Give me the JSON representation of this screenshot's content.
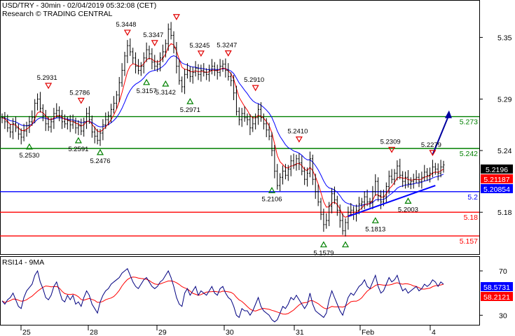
{
  "header": {
    "title": "USD/TRY - 30min - 02/04/2019 05:32:08 (CET)",
    "subtitle": "Research © TRADING CENTRAL"
  },
  "rsi_panel": {
    "label": "RSI14 - 9MA"
  },
  "chart_data": [
    {
      "type": "line",
      "name": "price",
      "title": "USD/TRY - 30min - 02/04/2019 05:32:08 (CET)",
      "ylim": [
        5.14,
        5.385
      ],
      "y_ticks": [
        5.18,
        5.24,
        5.29,
        5.35
      ],
      "x_ticks": [
        "25",
        "28",
        "29",
        "30",
        "31",
        "Feb",
        "4"
      ],
      "series": [
        {
          "role": "close",
          "color": "#000000",
          "values": [
            5.272,
            5.268,
            5.262,
            5.258,
            5.266,
            5.262,
            5.256,
            5.253,
            5.259,
            5.264,
            5.268,
            5.272,
            5.286,
            5.29,
            5.281,
            5.274,
            5.266,
            5.263,
            5.268,
            5.276,
            5.279,
            5.274,
            5.268,
            5.266,
            5.269,
            5.265,
            5.268,
            5.262,
            5.264,
            5.259,
            5.268,
            5.276,
            5.27,
            5.258,
            5.254,
            5.25,
            5.257,
            5.265,
            5.27,
            5.274,
            5.28,
            5.286,
            5.294,
            5.306,
            5.318,
            5.332,
            5.342,
            5.336,
            5.33,
            5.322,
            5.318,
            5.322,
            5.33,
            5.338,
            5.334,
            5.326,
            5.322,
            5.324,
            5.33,
            5.336,
            5.344,
            5.358,
            5.352,
            5.34,
            5.322,
            5.308,
            5.302,
            5.314,
            5.318,
            5.312,
            5.316,
            5.32,
            5.314,
            5.318,
            5.316,
            5.314,
            5.318,
            5.322,
            5.318,
            5.316,
            5.322,
            5.324,
            5.318,
            5.312,
            5.308,
            5.296,
            5.278,
            5.27,
            5.276,
            5.272,
            5.27,
            5.262,
            5.266,
            5.272,
            5.28,
            5.272,
            5.266,
            5.26,
            5.254,
            5.24,
            5.22,
            5.206,
            5.214,
            5.22,
            5.216,
            5.222,
            5.23,
            5.226,
            5.232,
            5.228,
            5.22,
            5.212,
            5.218,
            5.232,
            5.212,
            5.2,
            5.19,
            5.178,
            5.168,
            5.172,
            5.186,
            5.198,
            5.192,
            5.182,
            5.172,
            5.162,
            5.17,
            5.18,
            5.182,
            5.178,
            5.182,
            5.188,
            5.19,
            5.195,
            5.19,
            5.19,
            5.2,
            5.21,
            5.196,
            5.19,
            5.195,
            5.205,
            5.215,
            5.212,
            5.218,
            5.225,
            5.216,
            5.21,
            5.214,
            5.208,
            5.21,
            5.212,
            5.214,
            5.21,
            5.214,
            5.219,
            5.216,
            5.218,
            5.224,
            5.222,
            5.218,
            5.224,
            5.226
          ]
        },
        {
          "role": "ma-fast",
          "color": "#ff0000"
        },
        {
          "role": "ma-slow",
          "color": "#0000ff"
        }
      ],
      "horizontal_lines": [
        {
          "value": 5.273,
          "label": "5.273",
          "color": "#008000"
        },
        {
          "value": 5.242,
          "label": "5.242",
          "color": "#008000"
        },
        {
          "value": 5.2,
          "label": "5.2",
          "color": "#0000ff"
        },
        {
          "value": 5.18,
          "label": "5.18",
          "color": "#ff0000"
        },
        {
          "value": 5.157,
          "label": "5.157",
          "color": "#ff0000"
        }
      ],
      "trend_line": {
        "from": [
          127,
          5.176
        ],
        "to": [
          159,
          5.206
        ],
        "color": "#0000ff"
      },
      "projection_arrow": {
        "from": [
          158,
          5.236
        ],
        "to": [
          163,
          5.279
        ],
        "color": "#0000a0"
      },
      "price_tags": [
        {
          "value": 5.2196,
          "label": "5.2196",
          "bg": "#000000"
        },
        {
          "value": 5.2118,
          "label": "5.21187",
          "bg": "#ff0000"
        },
        {
          "value": 5.2085,
          "label": "5.20854",
          "bg": "#0000ff"
        }
      ],
      "swing_labels": [
        {
          "text": "5.2931",
          "x": 17,
          "value": 5.2931,
          "dir": "high"
        },
        {
          "text": "5.2786",
          "x": 29,
          "value": 5.2786,
          "dir": "high"
        },
        {
          "text": "5.3448",
          "x": 46,
          "value": 5.3448,
          "dir": "high"
        },
        {
          "text": "5.3347",
          "x": 56,
          "value": 5.3347,
          "dir": "high"
        },
        {
          "text": "",
          "x": 64,
          "value": 5.36,
          "dir": "high"
        },
        {
          "text": "5.3245",
          "x": 73,
          "value": 5.3245,
          "dir": "high"
        },
        {
          "text": "5.3247",
          "x": 83,
          "value": 5.3247,
          "dir": "high"
        },
        {
          "text": "5.2910",
          "x": 93,
          "value": 5.291,
          "dir": "high"
        },
        {
          "text": "5.2410",
          "x": 109,
          "value": 5.241,
          "dir": "high"
        },
        {
          "text": "5.2309",
          "x": 143,
          "value": 5.2309,
          "dir": "high"
        },
        {
          "text": "5.2279",
          "x": 158,
          "value": 5.2279,
          "dir": "high"
        },
        {
          "text": "5.2530",
          "x": 10,
          "value": 5.253,
          "dir": "low"
        },
        {
          "text": "5.2591",
          "x": 28,
          "value": 5.2591,
          "dir": "low"
        },
        {
          "text": "5.2476",
          "x": 36,
          "value": 5.2476,
          "dir": "low"
        },
        {
          "text": "5.3157",
          "x": 53,
          "value": 5.3157,
          "dir": "low"
        },
        {
          "text": "5.3142",
          "x": 60,
          "value": 5.3142,
          "dir": "low"
        },
        {
          "text": "5.2971",
          "x": 69,
          "value": 5.2971,
          "dir": "low"
        },
        {
          "text": "5.2106",
          "x": 99,
          "value": 5.2106,
          "dir": "low"
        },
        {
          "text": "5.1579",
          "x": 118,
          "value": 5.1579,
          "dir": "low"
        },
        {
          "text": "",
          "x": 126,
          "value": 5.1579,
          "dir": "low"
        },
        {
          "text": "5.1813",
          "x": 137,
          "value": 5.1813,
          "dir": "low"
        },
        {
          "text": "5.2003",
          "x": 149,
          "value": 5.2003,
          "dir": "low"
        }
      ]
    },
    {
      "type": "line",
      "name": "RSI14 - 9MA",
      "ylim": [
        22,
        82
      ],
      "y_ticks": [
        30,
        70
      ],
      "series": [
        {
          "role": "rsi",
          "color": "#000080",
          "values": [
            43,
            40,
            44,
            46,
            50,
            44,
            38,
            36,
            46,
            52,
            55,
            58,
            66,
            70,
            60,
            54,
            46,
            44,
            48,
            56,
            60,
            52,
            44,
            42,
            48,
            44,
            48,
            40,
            42,
            38,
            46,
            52,
            48,
            40,
            36,
            32,
            42,
            48,
            52,
            54,
            58,
            60,
            62,
            64,
            68,
            70,
            72,
            66,
            60,
            56,
            54,
            58,
            62,
            64,
            60,
            56,
            54,
            56,
            60,
            62,
            66,
            70,
            64,
            56,
            46,
            40,
            38,
            50,
            54,
            48,
            52,
            56,
            48,
            52,
            50,
            48,
            52,
            56,
            50,
            48,
            54,
            56,
            50,
            46,
            44,
            38,
            30,
            28,
            36,
            34,
            34,
            30,
            34,
            40,
            46,
            38,
            34,
            32,
            30,
            26,
            24,
            26,
            32,
            38,
            36,
            40,
            46,
            44,
            48,
            44,
            40,
            36,
            40,
            50,
            40,
            34,
            32,
            30,
            28,
            32,
            44,
            52,
            46,
            40,
            34,
            30,
            38,
            46,
            50,
            48,
            52,
            56,
            58,
            62,
            56,
            54,
            60,
            66,
            56,
            50,
            52,
            58,
            64,
            60,
            62,
            66,
            58,
            52,
            54,
            50,
            52,
            54,
            56,
            52,
            54,
            58,
            56,
            58,
            62,
            60,
            56,
            60,
            58
          ]
        },
        {
          "role": "rsi-ma9",
          "color": "#ff0000"
        }
      ],
      "price_tags": [
        {
          "value": 58.5731,
          "label": "58.5731",
          "bg": "#0000ff"
        },
        {
          "value": 58.2121,
          "label": "58.2121",
          "bg": "#ff0000"
        }
      ]
    }
  ]
}
